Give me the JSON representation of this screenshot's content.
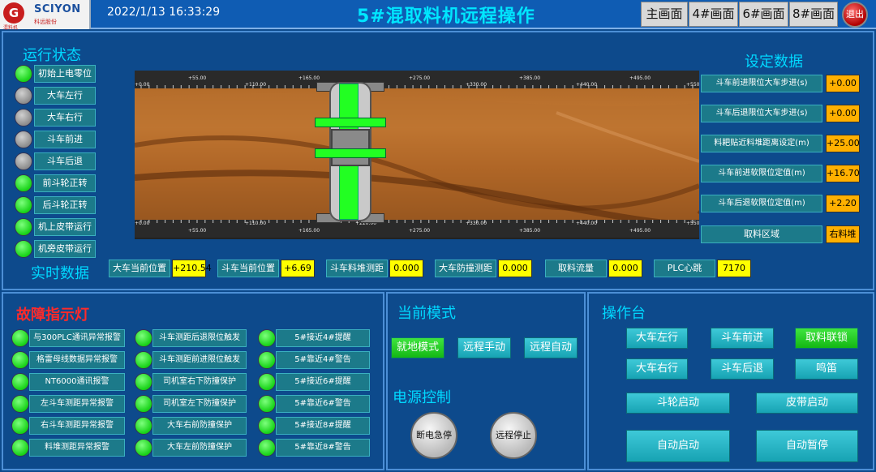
{
  "header": {
    "logo": {
      "brand": "SCIYON",
      "sub": "科远股份",
      "caption": "混料机",
      "icon": "logo-icon"
    },
    "datetime": "2022/1/13 16:33:29",
    "title": "5#混取料机远程操作",
    "nav": [
      "主画面",
      "4#画面",
      "6#画面",
      "8#画面"
    ],
    "exit_label": "退出"
  },
  "run_status": {
    "title": "运行状态",
    "items": [
      {
        "label": "初始上电零位",
        "state": "on"
      },
      {
        "label": "大车左行",
        "state": "off"
      },
      {
        "label": "大车右行",
        "state": "off"
      },
      {
        "label": "斗车前进",
        "state": "off"
      },
      {
        "label": "斗车后退",
        "state": "off"
      },
      {
        "label": "前斗轮正转",
        "state": "on"
      },
      {
        "label": "后斗轮正转",
        "state": "on"
      },
      {
        "label": "机上皮带运行",
        "state": "on"
      },
      {
        "label": "机旁皮带运行",
        "state": "on"
      }
    ]
  },
  "scale": {
    "top_major": [
      "+0.00",
      "+110.00",
      "+220.00",
      "+330.00",
      "+440.00",
      "+550.00"
    ],
    "top_minor": [
      "+55.00",
      "+165.00",
      "+275.00",
      "+385.00",
      "+495.00"
    ],
    "bot_major": [
      "+0.00",
      "+110.00",
      "+220.00",
      "+330.00",
      "+440.00",
      "+550.00"
    ],
    "bot_minor": [
      "+55.00",
      "+165.00",
      "+275.00",
      "+385.00",
      "+495.00"
    ]
  },
  "realtime": {
    "title": "实时数据",
    "items": [
      {
        "label": "大车当前位置",
        "value": "+210.54"
      },
      {
        "label": "斗车当前位置",
        "value": "+6.69"
      },
      {
        "label": "斗车料堆测距",
        "value": "0.000"
      },
      {
        "label": "大车防撞测距",
        "value": "0.000"
      },
      {
        "label": "取料流量",
        "value": "0.000"
      },
      {
        "label": "PLC心跳",
        "value": "7170"
      }
    ]
  },
  "settings": {
    "title": "设定数据",
    "items": [
      {
        "label": "斗车前进限位大车步进(s)",
        "value": "+0.00"
      },
      {
        "label": "斗车后退限位大车步进(s)",
        "value": "+0.00"
      },
      {
        "label": "料耙贴近料堆距离设定(m)",
        "value": "+25.00"
      },
      {
        "label": "斗车前进软限位定值(m)",
        "value": "+16.70"
      },
      {
        "label": "斗车后退软限位定值(m)",
        "value": "+2.20"
      }
    ],
    "area_label": "取料区域",
    "area_value": "右料堆"
  },
  "faults": {
    "title": "故障指示灯",
    "col1": [
      "与300PLC通讯异常报警",
      "格雷母线数据异常报警",
      "NT6000通讯报警",
      "左斗车测距异常报警",
      "右斗车测距异常报警",
      "料堆测距异常报警"
    ],
    "col2": [
      "斗车测距后退限位触发",
      "斗车测距前进限位触发",
      "司机室右下防撞保护",
      "司机室左下防撞保护",
      "大车右前防撞保护",
      "大车左前防撞保护"
    ],
    "col3": [
      "5#接近4#提醒",
      "5#靠近4#警告",
      "5#接近6#提醒",
      "5#靠近6#警告",
      "5#接近8#提醒",
      "5#靠近8#警告"
    ]
  },
  "mode": {
    "title": "当前模式",
    "buttons": [
      "就地模式",
      "远程手动",
      "远程自动"
    ],
    "power_title": "电源控制",
    "power_buttons": [
      "断电急停",
      "远程停止"
    ]
  },
  "console": {
    "title": "操作台",
    "row1": [
      "大车左行",
      "斗车前进",
      "取料联锁"
    ],
    "row2": [
      "大车右行",
      "斗车后退",
      "鸣笛"
    ],
    "row3": [
      "斗轮启动",
      "皮带启动"
    ],
    "row4": [
      "自动启动",
      "自动暂停"
    ]
  },
  "colors": {
    "led_on": "#17d217",
    "led_off": "#8c8c8c",
    "value_bg": "#ffff00",
    "tag_bg": "#1c7a8a",
    "title": "#00e6ff",
    "fault_title": "#ff2a2a"
  }
}
